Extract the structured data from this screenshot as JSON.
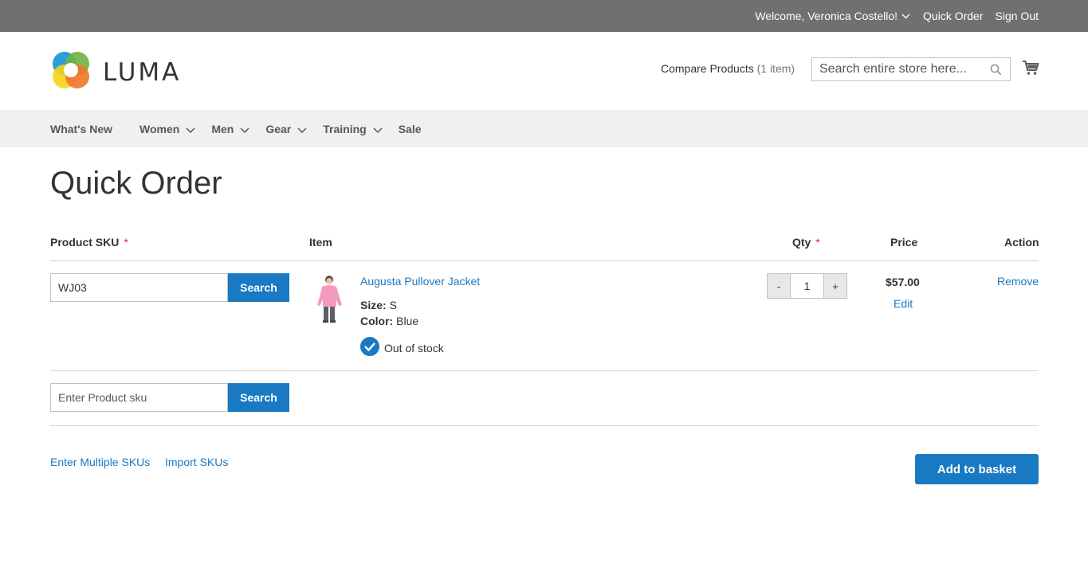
{
  "topbar": {
    "welcome": "Welcome, Veronica Costello!",
    "quick_order": "Quick Order",
    "sign_out": "Sign Out"
  },
  "header": {
    "logo_text": "LUMA",
    "compare_label": "Compare Products",
    "compare_count": "(1 item)",
    "search_placeholder": "Search entire store here..."
  },
  "nav": {
    "items": [
      {
        "label": "What's New"
      },
      {
        "label": "Women"
      },
      {
        "label": "Men"
      },
      {
        "label": "Gear"
      },
      {
        "label": "Training"
      },
      {
        "label": "Sale"
      }
    ]
  },
  "main": {
    "title": "Quick Order",
    "columns": {
      "sku": "Product SKU",
      "item": "Item",
      "qty": "Qty",
      "price": "Price",
      "action": "Action",
      "required_mark": "*"
    },
    "rows": [
      {
        "sku_value": "WJ03",
        "search_label": "Search",
        "product_name": "Augusta Pullover Jacket",
        "size_label": "Size:",
        "size_value": "S",
        "color_label": "Color:",
        "color_value": "Blue",
        "stock_status": "Out of stock",
        "qty_minus": "-",
        "qty_value": "1",
        "qty_plus": "+",
        "price": "$57.00",
        "edit_label": "Edit",
        "remove_label": "Remove"
      }
    ],
    "new_row": {
      "placeholder": "Enter Product sku",
      "search_label": "Search"
    },
    "footer": {
      "enter_multiple": "Enter Multiple SKUs",
      "import": "Import SKUs",
      "add_to_basket": "Add to basket"
    }
  },
  "colors": {
    "topbar_bg": "#6e716e",
    "nav_bg": "#f0f0f0",
    "primary_blue": "#1979c3",
    "required_red": "#e02b27"
  }
}
